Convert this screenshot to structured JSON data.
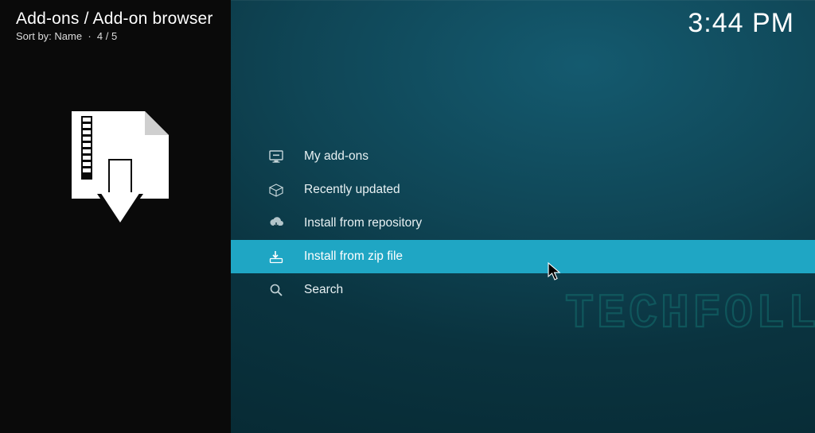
{
  "header": {
    "crumb": "Add-ons / Add-on browser",
    "sort_prefix": "Sort by: ",
    "sort_value": "Name",
    "position": "4 / 5"
  },
  "clock": "3:44 PM",
  "menu": {
    "items": [
      {
        "label": "My add-ons",
        "icon": "display-icon",
        "selected": false
      },
      {
        "label": "Recently updated",
        "icon": "open-box-icon",
        "selected": false
      },
      {
        "label": "Install from repository",
        "icon": "cloud-download-icon",
        "selected": false
      },
      {
        "label": "Install from zip file",
        "icon": "zip-download-icon",
        "selected": true
      },
      {
        "label": "Search",
        "icon": "search-icon",
        "selected": false
      }
    ]
  },
  "watermark": "TECHFOLLOWS"
}
